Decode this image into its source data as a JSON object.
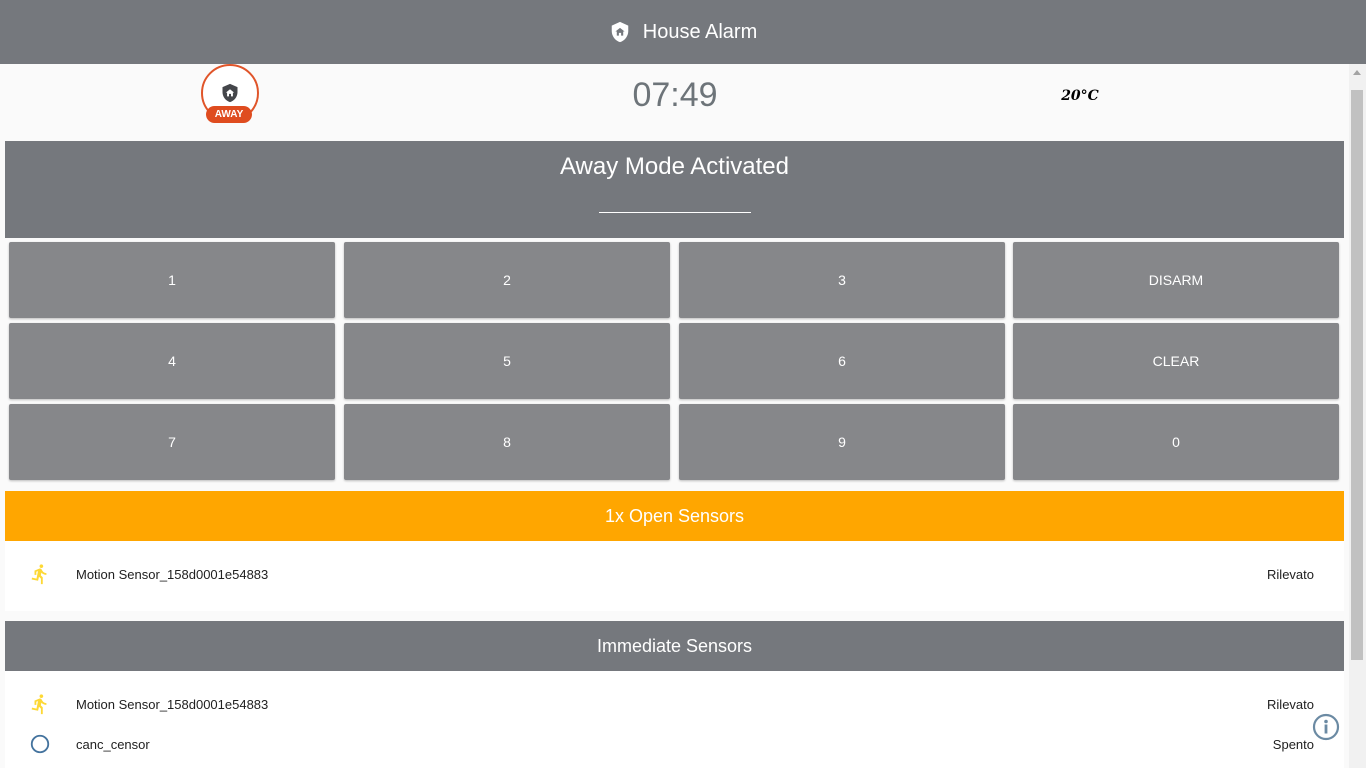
{
  "header": {
    "title": "House Alarm",
    "icon": "shield-home-icon"
  },
  "status": {
    "mode_badge": "AWAY",
    "badge_icon": "shield-home-icon",
    "time": "07:49",
    "temperature": "20°C",
    "accent_color": "#df4c1f"
  },
  "mode_card": {
    "title": "Away Mode Activated",
    "code_value": ""
  },
  "keypad": {
    "keys": [
      "1",
      "2",
      "3",
      "DISARM",
      "4",
      "5",
      "6",
      "CLEAR",
      "7",
      "8",
      "9",
      "0"
    ]
  },
  "open_sensors": {
    "title": "1x Open Sensors",
    "color": "#ffa600",
    "items": [
      {
        "icon": "run-icon",
        "name": "Motion Sensor_158d0001e54883",
        "state": "Rilevato"
      }
    ]
  },
  "immediate_sensors": {
    "title": "Immediate Sensors",
    "items": [
      {
        "icon": "run-icon",
        "name": "Motion Sensor_158d0001e54883",
        "state": "Rilevato"
      },
      {
        "icon": "circle-outline-icon",
        "name": "canc_censor",
        "state": "Spento"
      }
    ]
  },
  "info_button": {
    "icon": "info-icon"
  }
}
